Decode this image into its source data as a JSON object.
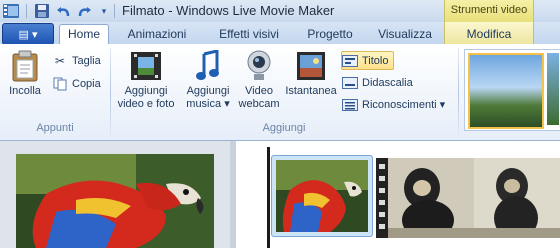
{
  "window": {
    "title": "Filmato - Windows Live Movie Maker",
    "context_group": "Strumenti video"
  },
  "tabs": [
    {
      "label": "Home",
      "active": true
    },
    {
      "label": "Animazioni"
    },
    {
      "label": "Effetti visivi"
    },
    {
      "label": "Progetto"
    },
    {
      "label": "Visualizza"
    },
    {
      "label": "Modifica",
      "contextual": true
    }
  ],
  "ribbon": {
    "appunti": {
      "label": "Appunti",
      "incolla": "Incolla",
      "taglia": "Taglia",
      "copia": "Copia"
    },
    "aggiungi": {
      "label": "Aggiungi",
      "video_foto_line1": "Aggiungi",
      "video_foto_line2": "video e foto",
      "musica_line1": "Aggiungi",
      "musica_line2": "musica",
      "webcam_line1": "Video",
      "webcam_line2": "webcam",
      "istantanea": "Istantanea",
      "titolo": "Titolo",
      "didascalia": "Didascalia",
      "riconoscimenti": "Riconoscimenti"
    }
  },
  "colors": {
    "accent": "#1e55b3",
    "context_tab": "#f5f0a6",
    "highlight": "#ffe08a"
  }
}
